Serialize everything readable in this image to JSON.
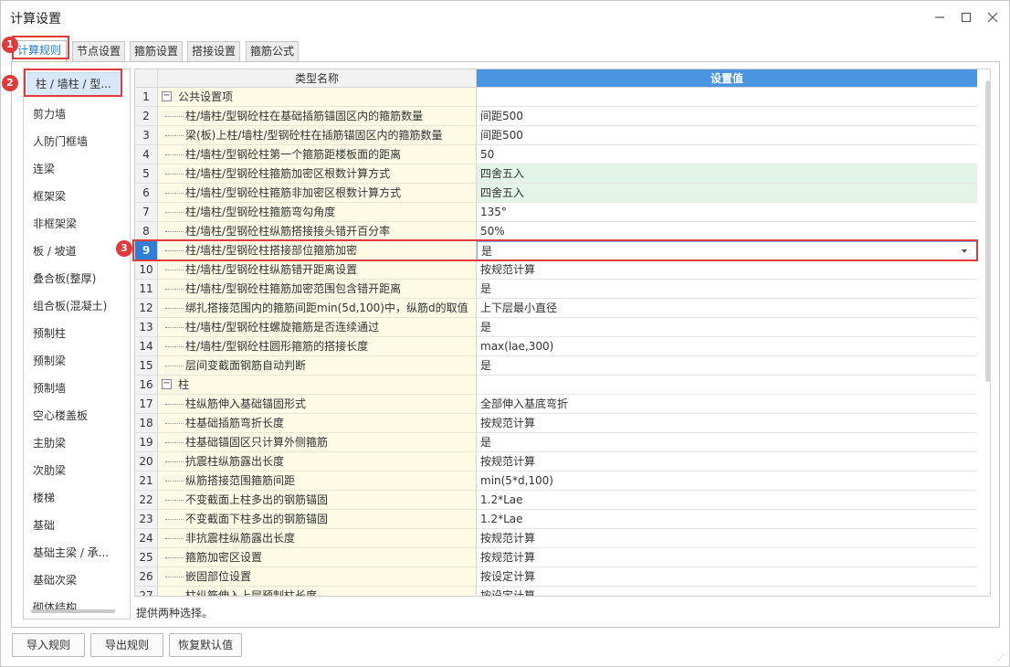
{
  "window": {
    "title": "计算设置"
  },
  "tabs": [
    {
      "label": "计算规则"
    },
    {
      "label": "节点设置"
    },
    {
      "label": "箍筋设置"
    },
    {
      "label": "搭接设置"
    },
    {
      "label": "箍筋公式"
    }
  ],
  "sidebar": {
    "items": [
      {
        "label": "柱 / 墙柱 / 型..."
      },
      {
        "label": "剪力墙"
      },
      {
        "label": "人防门框墙"
      },
      {
        "label": "连梁"
      },
      {
        "label": "框架梁"
      },
      {
        "label": "非框架梁"
      },
      {
        "label": "板 / 坡道"
      },
      {
        "label": "叠合板(整厚)"
      },
      {
        "label": "组合板(混凝土)"
      },
      {
        "label": "预制柱"
      },
      {
        "label": "预制梁"
      },
      {
        "label": "预制墙"
      },
      {
        "label": "空心楼盖板"
      },
      {
        "label": "主肋梁"
      },
      {
        "label": "次肋梁"
      },
      {
        "label": "楼梯"
      },
      {
        "label": "基础"
      },
      {
        "label": "基础主梁 / 承..."
      },
      {
        "label": "基础次梁"
      },
      {
        "label": "砌体结构"
      }
    ]
  },
  "grid": {
    "headers": {
      "name": "类型名称",
      "value": "设置值"
    },
    "rows": [
      {
        "num": "1",
        "name": "公共设置项",
        "value": "",
        "category": true
      },
      {
        "num": "2",
        "name": "柱/墙柱/型钢砼柱在基础插筋锚固区内的箍筋数量",
        "value": "间距500"
      },
      {
        "num": "3",
        "name": "梁(板)上柱/墙柱/型钢砼柱在插筋锚固区内的箍筋数量",
        "value": "间距500"
      },
      {
        "num": "4",
        "name": "柱/墙柱/型钢砼柱第一个箍筋距楼板面的距离",
        "value": "50"
      },
      {
        "num": "5",
        "name": "柱/墙柱/型钢砼柱箍筋加密区根数计算方式",
        "value": "四舍五入",
        "green": true
      },
      {
        "num": "6",
        "name": "柱/墙柱/型钢砼柱箍筋非加密区根数计算方式",
        "value": "四舍五入",
        "green": true
      },
      {
        "num": "7",
        "name": "柱/墙柱/型钢砼柱箍筋弯勾角度",
        "value": "135°"
      },
      {
        "num": "8",
        "name": "柱/墙柱/型钢砼柱纵筋搭接接头错开百分率",
        "value": "50%"
      },
      {
        "num": "9",
        "name": "柱/墙柱/型钢砼柱搭接部位箍筋加密",
        "value": "是",
        "selected": true
      },
      {
        "num": "10",
        "name": "柱/墙柱/型钢砼柱纵筋错开距离设置",
        "value": "按规范计算"
      },
      {
        "num": "11",
        "name": "柱/墙柱/型钢砼柱箍筋加密范围包含错开距离",
        "value": "是"
      },
      {
        "num": "12",
        "name": "绑扎搭接范围内的箍筋间距min(5d,100)中，纵筋d的取值",
        "value": "上下层最小直径"
      },
      {
        "num": "13",
        "name": "柱/墙柱/型钢砼柱螺旋箍筋是否连续通过",
        "value": "是"
      },
      {
        "num": "14",
        "name": "柱/墙柱/型钢砼柱圆形箍筋的搭接长度",
        "value": "max(lae,300)"
      },
      {
        "num": "15",
        "name": "层间变截面钢筋自动判断",
        "value": "是"
      },
      {
        "num": "16",
        "name": "柱",
        "value": "",
        "category": true
      },
      {
        "num": "17",
        "name": "柱纵筋伸入基础锚固形式",
        "value": "全部伸入基底弯折"
      },
      {
        "num": "18",
        "name": "柱基础插筋弯折长度",
        "value": "按规范计算"
      },
      {
        "num": "19",
        "name": "柱基础锚固区只计算外侧箍筋",
        "value": "是"
      },
      {
        "num": "20",
        "name": "抗震柱纵筋露出长度",
        "value": "按规范计算"
      },
      {
        "num": "21",
        "name": "纵筋搭接范围箍筋间距",
        "value": "min(5*d,100)"
      },
      {
        "num": "22",
        "name": "不变截面上柱多出的钢筋锚固",
        "value": "1.2*Lae"
      },
      {
        "num": "23",
        "name": "不变截面下柱多出的钢筋锚固",
        "value": "1.2*Lae"
      },
      {
        "num": "24",
        "name": "非抗震柱纵筋露出长度",
        "value": "按规范计算"
      },
      {
        "num": "25",
        "name": "箍筋加密区设置",
        "value": "按规范计算"
      },
      {
        "num": "26",
        "name": "嵌固部位设置",
        "value": "按设定计算"
      },
      {
        "num": "27",
        "name": "柱纵筋伸入上层预制柱长度",
        "value": "按设定计算"
      }
    ]
  },
  "hint": "提供两种选择。",
  "buttons": {
    "import": "导入规则",
    "export": "导出规则",
    "reset": "恢复默认值"
  },
  "annotations": [
    "1",
    "2",
    "3"
  ],
  "icons": {
    "minimize": "minimize-icon",
    "maximize": "maximize-icon",
    "close": "close-icon",
    "toggle": "minus-box-icon",
    "dropdown": "chevron-down-icon"
  },
  "colors": {
    "accent": "#2f7fd8",
    "header_value": "#4a95e0",
    "name_bg": "#fdfbe6",
    "green_bg": "#e3f5e8",
    "annotation": "#e03a3a"
  }
}
